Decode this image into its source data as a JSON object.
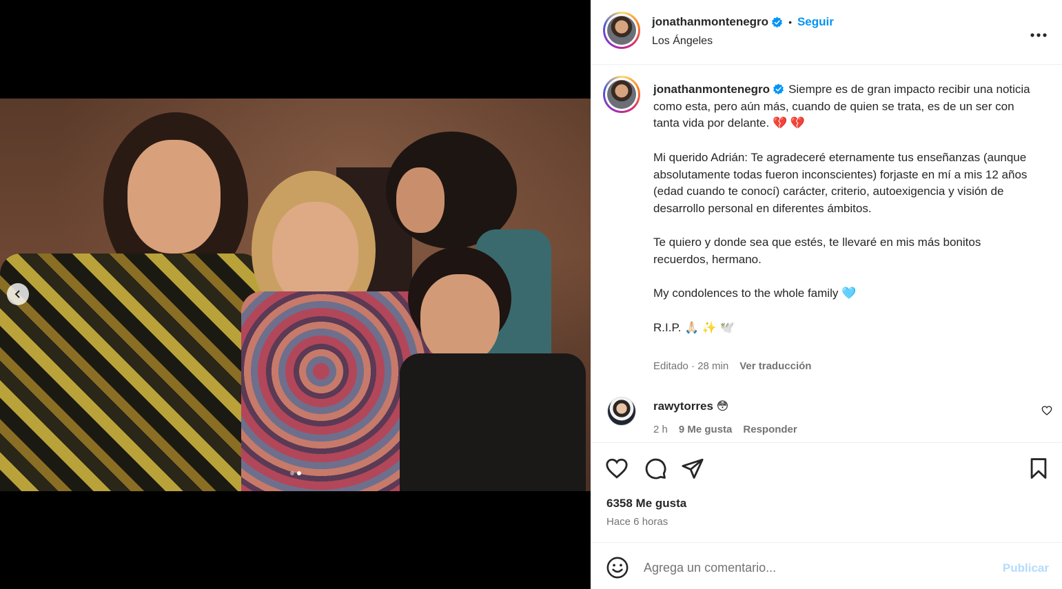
{
  "post": {
    "author": {
      "username": "jonathanmontenegro",
      "verified": true,
      "follow_label": "Seguir",
      "separator": "•",
      "location": "Los Ángeles"
    },
    "more_label": "•••",
    "media": {
      "slide_count": 2,
      "active_slide": 2,
      "prev_icon": "chevron-left-icon",
      "description_icon": "photo"
    },
    "caption": {
      "username": "jonathanmontenegro",
      "paragraphs": [
        "Siempre es de gran impacto recibir una noticia como esta, pero aún más, cuando de quien se trata, es de un ser con tanta vida por delante. 💔 💔",
        "Mi querido Adrián: Te agradeceré eternamente tus enseñanzas (aunque absolutamente todas fueron inconscientes) forjaste en mí a mis 12 años (edad cuando te conocí) carácter, criterio, autoexigencia y visión de desarrollo personal en diferentes ámbitos.",
        "Te quiero y donde sea que estés, te llevaré en mis más bonitos recuerdos, hermano.",
        "My condolences to the whole family 🩵",
        "R.I.P. 🙏🏻 ✨ 🕊️"
      ],
      "edited_label": "Editado · 28 min",
      "translate_label": "Ver traducción"
    },
    "comments": [
      {
        "username": "rawytorres",
        "text": "😳",
        "time": "2 h",
        "likes_label": "9 Me gusta",
        "reply_label": "Responder"
      }
    ],
    "likes_label": "6358 Me gusta",
    "time_label": "Hace 6 horas",
    "comment_input": {
      "placeholder": "Agrega un comentario...",
      "value": "",
      "publish_label": "Publicar"
    },
    "colors": {
      "accent": "#0095f6",
      "publish_disabled": "#b3dbff",
      "text": "#262626",
      "muted": "#737373"
    }
  }
}
